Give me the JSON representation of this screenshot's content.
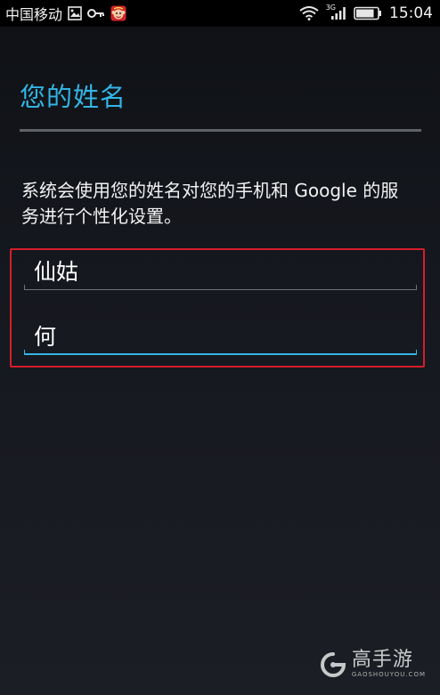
{
  "status_bar": {
    "carrier": "中国移动",
    "network": "3G",
    "time": "15:04",
    "icons": [
      "image-icon",
      "key-icon",
      "monkey-app-icon",
      "wifi-icon",
      "signal-icon",
      "battery-icon"
    ],
    "battery_level": 0.85
  },
  "page": {
    "title": "您的姓名",
    "description": "系统会使用您的姓名对您的手机和 Google 的服务进行个性化设置。"
  },
  "form": {
    "first_name": "仙姑",
    "last_name": "何"
  },
  "watermark": {
    "name": "高手游",
    "domain": "GAOSHOUYOU.COM"
  },
  "colors": {
    "accent": "#33b5e5",
    "highlight_border": "#d51e2b",
    "status_bar_bg": "#000000"
  }
}
